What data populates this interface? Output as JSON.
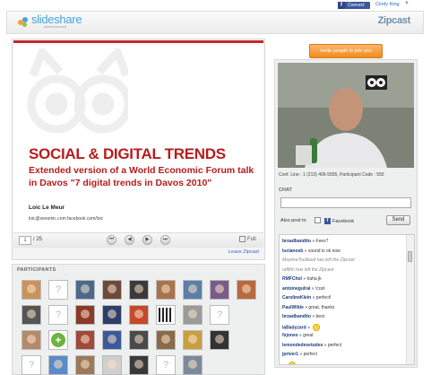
{
  "topbar": {
    "facebook_connect": "Connect",
    "user_name": "Cindy King",
    "caret": "▼"
  },
  "header": {
    "logo_name": "slideshare",
    "logo_sub": "present yourself",
    "zipcast_label": "Zipcast"
  },
  "slide": {
    "title": "SOCIAL & DIGITAL TRENDS",
    "subtitle": "Extended version of a World Economic Forum talk in Davos \"7 digital trends in Davos 2010\"",
    "author": "Loic Le Meur",
    "contact": "loic@seesmic.com  facebook.com/loic",
    "current_page": "1",
    "total_pages": "/ 25",
    "full_label": "Full",
    "leave_label": "Leave Zipcast"
  },
  "participants": {
    "title": "PARTICIPANTS",
    "avatars": [
      {
        "kind": "photo",
        "color": "#c9935e"
      },
      {
        "kind": "placeholder",
        "color": "#ffffff"
      },
      {
        "kind": "photo",
        "color": "#4b6a8a"
      },
      {
        "kind": "photo",
        "color": "#6a4a3a"
      },
      {
        "kind": "photo",
        "color": "#3b3b3b"
      },
      {
        "kind": "photo",
        "color": "#a7744d"
      },
      {
        "kind": "photo",
        "color": "#5a7fa8"
      },
      {
        "kind": "photo",
        "color": "#7a5c8a"
      },
      {
        "kind": "photo",
        "color": "#b86a3e"
      },
      {
        "kind": "photo",
        "color": "#555555"
      },
      {
        "kind": "placeholder",
        "color": "#ffffff"
      },
      {
        "kind": "photo",
        "color": "#8a3a2a"
      },
      {
        "kind": "photo",
        "color": "#2c3e6a"
      },
      {
        "kind": "photo",
        "color": "#c44a2a"
      },
      {
        "kind": "qrcode",
        "color": "#222222"
      },
      {
        "kind": "photo",
        "color": "#9a9a9a"
      },
      {
        "kind": "placeholder",
        "color": "#ffffff"
      },
      {
        "kind": "photo",
        "color": "#b58a6a"
      },
      {
        "kind": "plus",
        "color": "#6cb33f"
      },
      {
        "kind": "photo",
        "color": "#a04a3a"
      },
      {
        "kind": "photo",
        "color": "#3a5a9a"
      },
      {
        "kind": "photo",
        "color": "#4a4a4a"
      },
      {
        "kind": "photo",
        "color": "#8a6a4a"
      },
      {
        "kind": "photo",
        "color": "#c8a040"
      },
      {
        "kind": "photo",
        "color": "#333333"
      },
      {
        "kind": "placeholder",
        "color": "#ffffff"
      },
      {
        "kind": "photo",
        "color": "#5a8ac8"
      },
      {
        "kind": "photo",
        "color": "#9a7a5a"
      },
      {
        "kind": "photo",
        "color": "#cfcfcf"
      },
      {
        "kind": "photo",
        "color": "#3a3a3a"
      },
      {
        "kind": "placeholder",
        "color": "#ffffff"
      },
      {
        "kind": "photo",
        "color": "#7a8a9a"
      }
    ]
  },
  "right": {
    "invite_label": "Invite people to join you",
    "conf_line": "Conf. Line : 1 (213) 406-5555, Participant Code : 555",
    "chat_label": "CHAT",
    "also_post": "Also post to",
    "facebook_label": "Facebook",
    "send_label": "Send"
  },
  "chat": [
    {
      "who": "broadbandito",
      "text": "» Fees?",
      "kind": "msg"
    },
    {
      "who": "lucianosb",
      "text": "» sound is ok now",
      "kind": "msg"
    },
    {
      "who": "",
      "text": "MaximeTouillaud has left the Zipcast",
      "kind": "sys"
    },
    {
      "who": "",
      "text": "raffihn has left the Zipcast",
      "kind": "sys"
    },
    {
      "who": "RMFChol",
      "text": "» haha jk",
      "kind": "msg"
    },
    {
      "who": "antoinegulral",
      "text": "» !cool",
      "kind": "msg"
    },
    {
      "who": "CarolineKlein",
      "text": "» perfect!",
      "kind": "msg"
    },
    {
      "who": "PaulWible",
      "text": "» great, thanks",
      "kind": "msg"
    },
    {
      "who": "broadbandito",
      "text": "» best",
      "kind": "msg"
    },
    {
      "who": "laBadyzard",
      "text": "»",
      "kind": "smiley"
    },
    {
      "who": "fsjones",
      "text": "» great",
      "kind": "msg"
    },
    {
      "who": "lemondedesetudes",
      "text": "» perfect",
      "kind": "msg"
    },
    {
      "who": "jpriver1",
      "text": "» perfect",
      "kind": "msg"
    },
    {
      "who": "",
      "text": "...",
      "kind": "smiley"
    }
  ]
}
